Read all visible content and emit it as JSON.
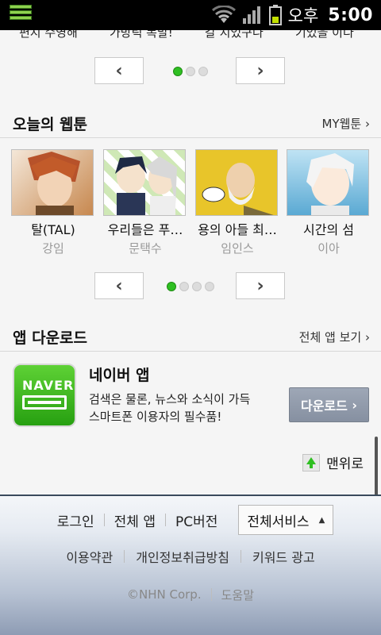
{
  "status_bar": {
    "ampm": "오후",
    "time": "5:00"
  },
  "top_cut_texts": [
    "편지 수영해",
    "가방릭 폭발!",
    "갈 지었구나",
    "기었을 이다"
  ],
  "webtoon_section": {
    "title": "오늘의 웹툰",
    "more_link": "MY웹툰",
    "items": [
      {
        "title": "탈(TAL)",
        "author": "강임"
      },
      {
        "title": "우리들은 푸…",
        "author": "문택수"
      },
      {
        "title": "용의 아들 최…",
        "author": "임인스"
      },
      {
        "title": "시간의 섬",
        "author": "이아"
      }
    ]
  },
  "app_section": {
    "title": "앱 다운로드",
    "more_link": "전체 앱 보기",
    "app_name": "네이버 앱",
    "icon_text": "NAVER",
    "desc_line1": "검색은 물론, 뉴스와 소식이 가득",
    "desc_line2": "스마트폰 이용자의 필수품!",
    "download_label": "다운로드"
  },
  "to_top_label": "맨위로",
  "footer": {
    "login": "로그인",
    "all_apps": "전체 앱",
    "pc_version": "PC버전",
    "all_services": "전체서비스",
    "terms": "이용약관",
    "privacy": "개인정보취급방침",
    "keyword_ad": "키워드 광고",
    "copyright": "©NHN Corp.",
    "help": "도움말"
  },
  "pager_top": {
    "pages": 3,
    "current": 1
  },
  "pager_webtoon": {
    "pages": 4,
    "current": 1
  }
}
